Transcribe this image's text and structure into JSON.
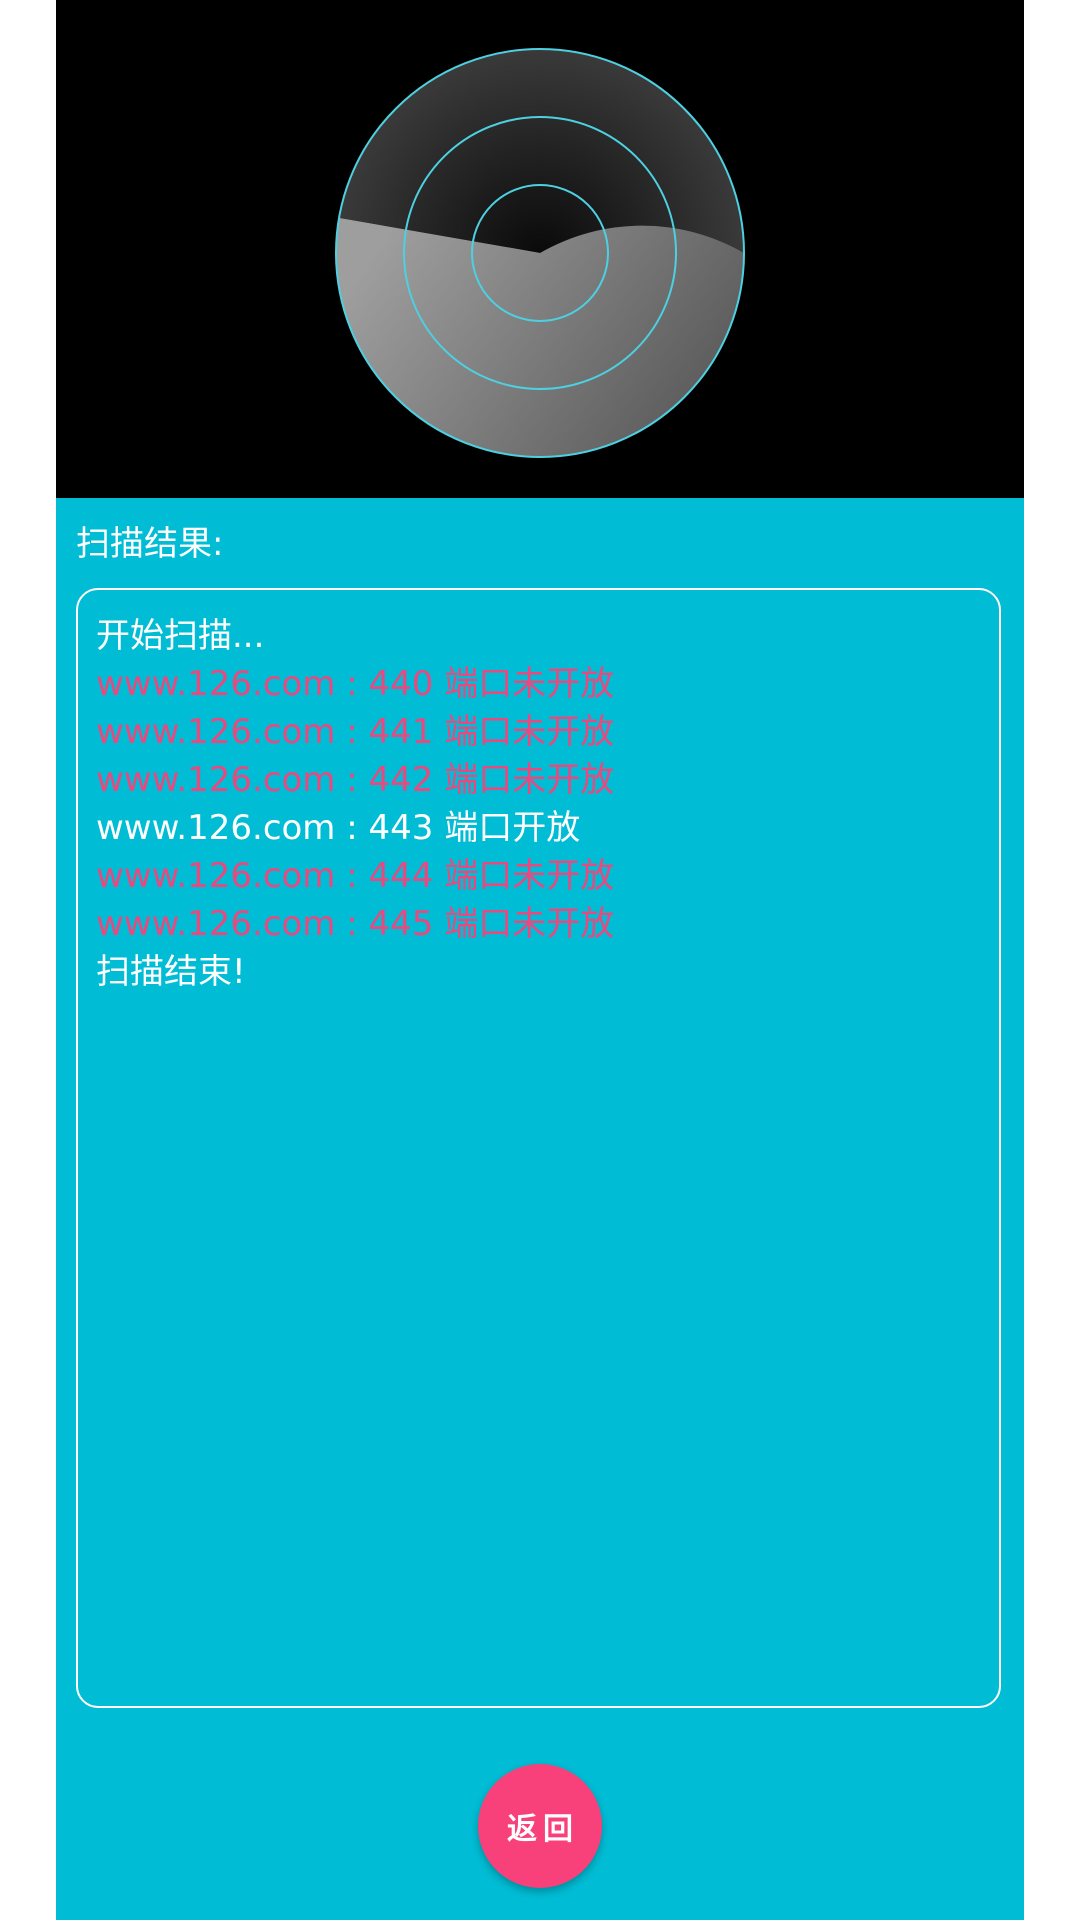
{
  "radar": {
    "ring_color": "#4DD0E1",
    "ring_count": 3
  },
  "result_label": "扫描结果:",
  "log": [
    {
      "text": "开始扫描...",
      "status": "info"
    },
    {
      "text": "www.126.com : 440 端口未开放",
      "status": "closed"
    },
    {
      "text": "www.126.com : 441 端口未开放",
      "status": "closed"
    },
    {
      "text": "www.126.com : 442 端口未开放",
      "status": "closed"
    },
    {
      "text": "www.126.com : 443 端口开放",
      "status": "open"
    },
    {
      "text": "www.126.com : 444 端口未开放",
      "status": "closed"
    },
    {
      "text": "www.126.com : 445 端口未开放",
      "status": "closed"
    },
    {
      "text": "扫描结束!",
      "status": "info"
    }
  ],
  "back_button": {
    "label": "返回"
  },
  "colors": {
    "background": "#00BCD4",
    "closed_text": "#E84A80",
    "button": "#F8407A"
  }
}
